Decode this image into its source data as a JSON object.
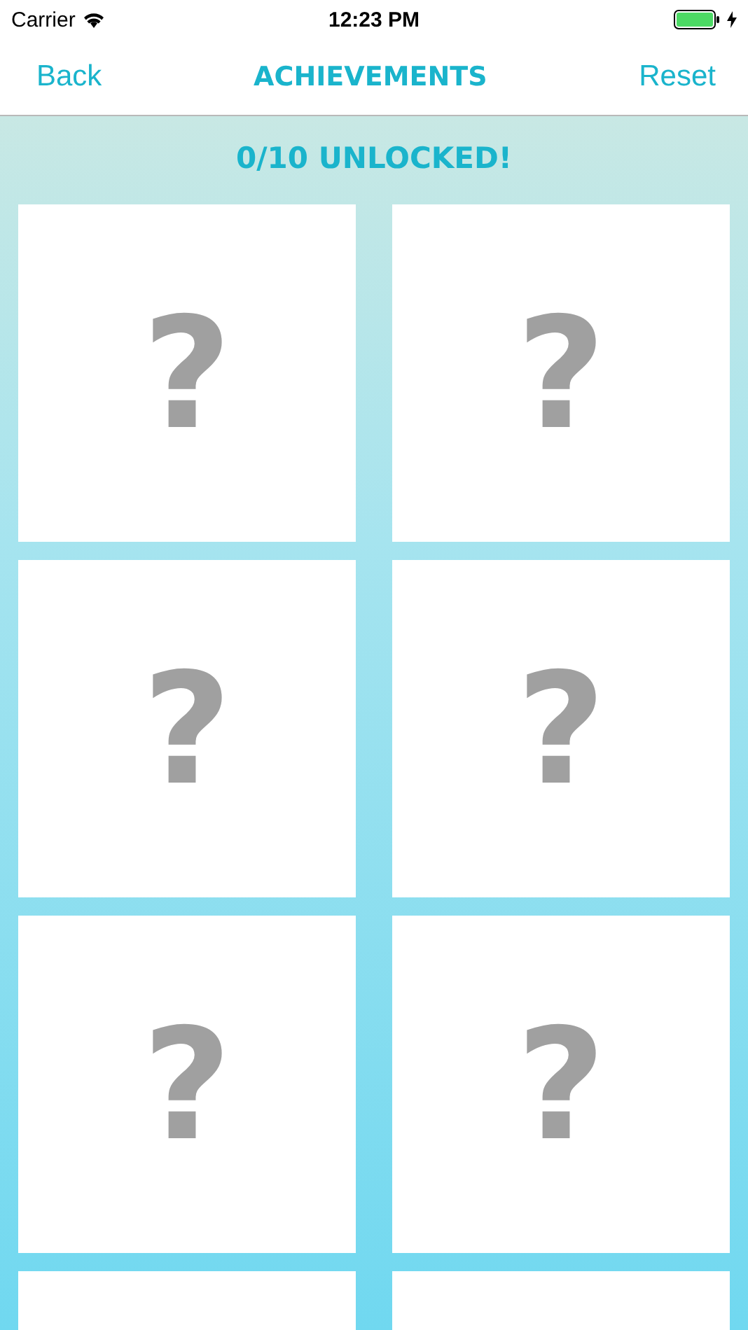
{
  "status_bar": {
    "carrier": "Carrier",
    "time": "12:23 PM",
    "charging": true
  },
  "nav_bar": {
    "back": "Back",
    "title": "ACHIEVEMENTS",
    "reset": "Reset"
  },
  "summary": "0/10 UNLOCKED!",
  "achievements": [
    {
      "locked": true,
      "symbol": "?"
    },
    {
      "locked": true,
      "symbol": "?"
    },
    {
      "locked": true,
      "symbol": "?"
    },
    {
      "locked": true,
      "symbol": "?"
    },
    {
      "locked": true,
      "symbol": "?"
    },
    {
      "locked": true,
      "symbol": "?"
    },
    {
      "locked": true
    },
    {
      "locked": true
    }
  ]
}
